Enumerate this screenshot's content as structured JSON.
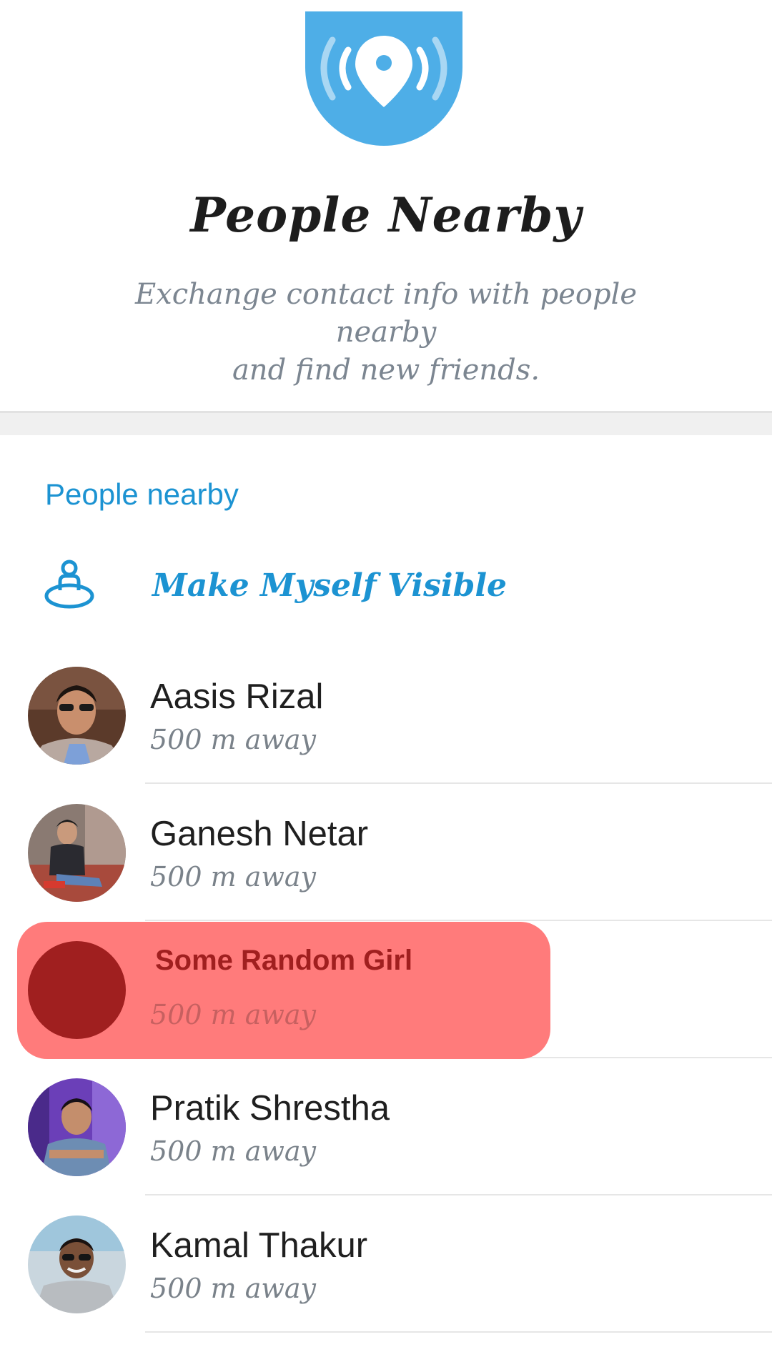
{
  "header": {
    "title": "People Nearby",
    "subtitle_line1": "Exchange contact info with people nearby",
    "subtitle_line2": "and find new friends."
  },
  "section": {
    "title": "People nearby",
    "make_visible": "Make Myself Visible"
  },
  "people": [
    {
      "name": "Aasis Rizal",
      "distance": "500 m away"
    },
    {
      "name": "Ganesh Netar",
      "distance": "500 m away"
    },
    {
      "name": "Some Random Girl",
      "distance": "500 m away"
    },
    {
      "name": "Pratik Shrestha",
      "distance": "500 m away"
    },
    {
      "name": "Kamal Thakur",
      "distance": "500 m away"
    }
  ],
  "colors": {
    "accent": "#1c93d2",
    "hero_icon_bg": "#4eaee7",
    "highlight": "#ff7b7b",
    "highlight_dark": "#a01f1f"
  },
  "icons": {
    "hero": "location-broadcast-icon",
    "visible": "person-on-location-icon"
  }
}
